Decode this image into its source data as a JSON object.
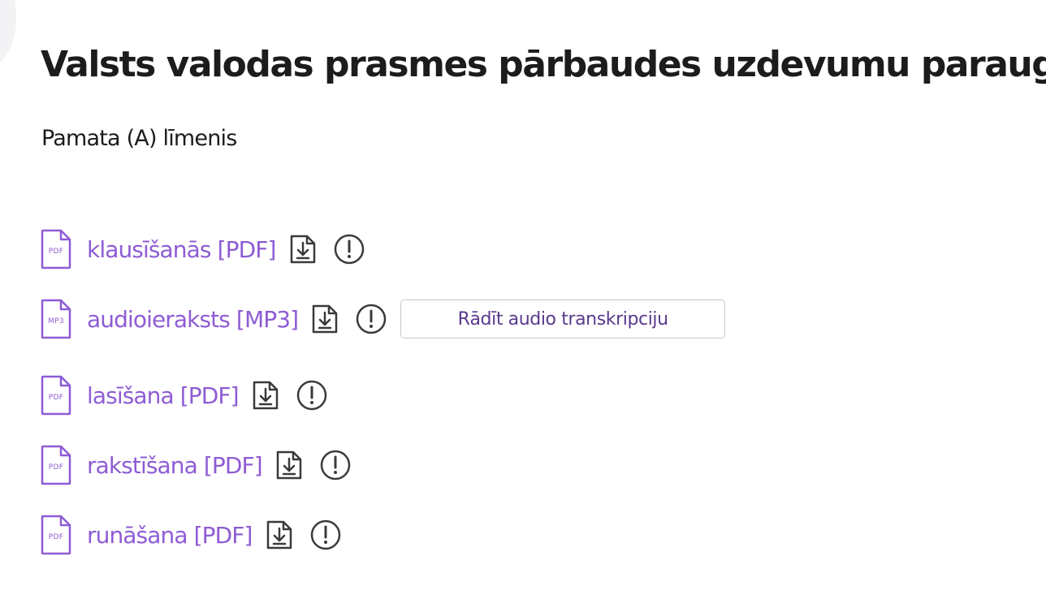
{
  "page": {
    "title": "Valsts valodas prasmes pārbaudes uzdevumu paraugi",
    "level": "Pamata (A) līmenis"
  },
  "colors": {
    "link": "#8e5cd4",
    "text": "#1c1c1c",
    "icon": "#3a3a3a",
    "button_text": "#5a3a8e",
    "button_border": "#c9c9cf"
  },
  "files": [
    {
      "ext": "PDF",
      "label": "klausīšanās [PDF]",
      "icon": "pdf-file-icon"
    },
    {
      "ext": "MP3",
      "label": "audioieraksts [MP3]",
      "icon": "mp3-file-icon",
      "button": "Rādīt audio transkripciju"
    },
    {
      "ext": "PDF",
      "label": "lasīšana [PDF]",
      "icon": "pdf-file-icon"
    },
    {
      "ext": "PDF",
      "label": "rakstīšana [PDF]",
      "icon": "pdf-file-icon"
    },
    {
      "ext": "PDF",
      "label": "runāšana [PDF]",
      "icon": "pdf-file-icon"
    }
  ],
  "icons": {
    "download": "download-icon",
    "info": "info-icon"
  }
}
